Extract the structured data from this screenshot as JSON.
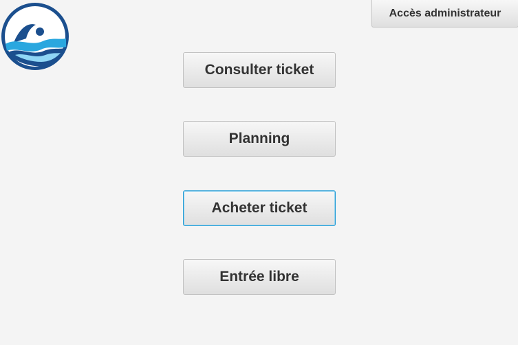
{
  "header": {
    "admin_button_label": "Accès administrateur"
  },
  "logo": {
    "icon": "swimmer-logo-icon",
    "ring_color": "#1b4f8e",
    "wave_colors": [
      "#1b4f8e",
      "#2aa7df",
      "#8fd6f5"
    ]
  },
  "menu": {
    "buttons": [
      {
        "label": "Consulter ticket"
      },
      {
        "label": "Planning"
      },
      {
        "label": "Acheter ticket",
        "focused": true
      },
      {
        "label": "Entrée libre"
      }
    ]
  },
  "colors": {
    "background": "#f4f4f4",
    "button_text": "#333333",
    "focus_border": "#2a9fd6"
  }
}
